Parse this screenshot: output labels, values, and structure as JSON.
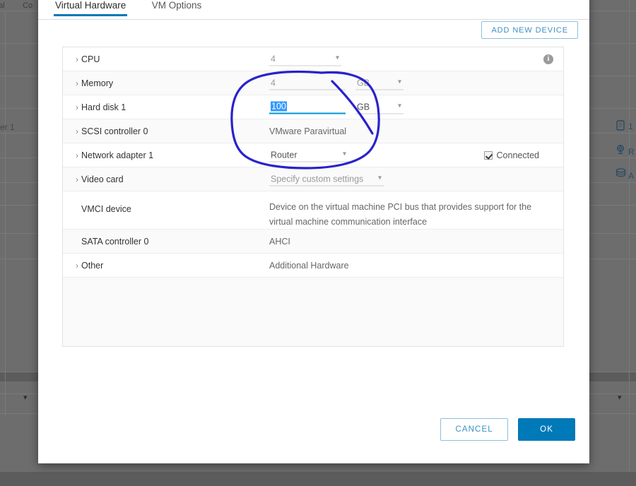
{
  "background": {
    "header_fragments": [
      "al",
      "Co"
    ],
    "row_label": "er 1",
    "side_items": [
      {
        "icon": "device-icon",
        "label": "1"
      },
      {
        "icon": "network-icon",
        "label": "R"
      },
      {
        "icon": "datastore-icon",
        "label": "A"
      }
    ],
    "chevron": "chevron-down-icon"
  },
  "dialog": {
    "tabs": [
      {
        "id": "virtual-hardware",
        "label": "Virtual Hardware",
        "active": true
      },
      {
        "id": "vm-options",
        "label": "VM Options",
        "active": false
      }
    ],
    "add_new_device_label": "ADD NEW DEVICE",
    "rows": [
      {
        "name": "cpu",
        "label": "CPU",
        "expandable": true,
        "control": "select",
        "value": "4",
        "unit": null,
        "info": true,
        "shade": "white"
      },
      {
        "name": "memory",
        "label": "Memory",
        "expandable": true,
        "control": "field-unit",
        "value": "4",
        "unit": "GB",
        "active": false,
        "shade": "grey"
      },
      {
        "name": "hard-disk-1",
        "label": "Hard disk 1",
        "expandable": true,
        "control": "field-unit",
        "value": "100",
        "unit": "GB",
        "active": true,
        "selected": true,
        "shade": "white"
      },
      {
        "name": "scsi-controller-0",
        "label": "SCSI controller 0",
        "expandable": true,
        "control": "text",
        "value": "VMware Paravirtual",
        "shade": "grey"
      },
      {
        "name": "network-adapter-1",
        "label": "Network adapter 1",
        "expandable": true,
        "control": "select",
        "value": "Router",
        "checkbox_label": "Connected",
        "checked": true,
        "shade": "white"
      },
      {
        "name": "video-card",
        "label": "Video card",
        "expandable": true,
        "control": "select",
        "value": "Specify custom settings",
        "shade": "grey"
      },
      {
        "name": "vmci-device",
        "label": "VMCI device",
        "expandable": false,
        "control": "text-wrap",
        "value": "Device on the virtual machine PCI bus that provides support for the virtual machine communication interface",
        "shade": "white"
      },
      {
        "name": "sata-controller-0",
        "label": "SATA controller 0",
        "expandable": false,
        "control": "text",
        "value": "AHCI",
        "shade": "grey"
      },
      {
        "name": "other",
        "label": "Other",
        "expandable": true,
        "control": "text",
        "value": "Additional Hardware",
        "shade": "white"
      }
    ],
    "footer": {
      "cancel_label": "CANCEL",
      "ok_label": "OK"
    }
  },
  "annotation": {
    "color": "#2a22cc",
    "shape": "hand-drawn-oval-with-stroke"
  },
  "colors": {
    "accent": "#0079b8",
    "link": "#3a91c4",
    "selection": "#3399ff",
    "active_underline": "#0095d3",
    "backdrop": "#6d6d6d",
    "annotation": "#2a22cc"
  }
}
